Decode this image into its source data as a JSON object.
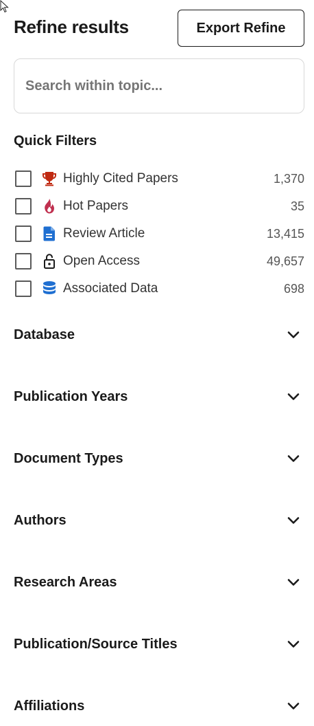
{
  "header": {
    "title": "Refine results",
    "export_label": "Export Refine"
  },
  "search": {
    "placeholder": "Search within topic..."
  },
  "quick_filters": {
    "title": "Quick Filters",
    "items": [
      {
        "label": "Highly Cited Papers",
        "count": "1,370",
        "icon": "trophy-icon",
        "color": "#c02a12"
      },
      {
        "label": "Hot Papers",
        "count": "35",
        "icon": "flame-icon",
        "color": "#c0304f"
      },
      {
        "label": "Review Article",
        "count": "13,415",
        "icon": "document-icon",
        "color": "#1f6fd1"
      },
      {
        "label": "Open Access",
        "count": "49,657",
        "icon": "unlock-icon",
        "color": "#1a1a1a"
      },
      {
        "label": "Associated Data",
        "count": "698",
        "icon": "database-icon",
        "color": "#1f6fd1"
      }
    ]
  },
  "facets": [
    {
      "label": "Database"
    },
    {
      "label": "Publication Years"
    },
    {
      "label": "Document Types"
    },
    {
      "label": "Authors"
    },
    {
      "label": "Research Areas"
    },
    {
      "label": "Publication/Source Titles"
    },
    {
      "label": "Affiliations"
    }
  ]
}
